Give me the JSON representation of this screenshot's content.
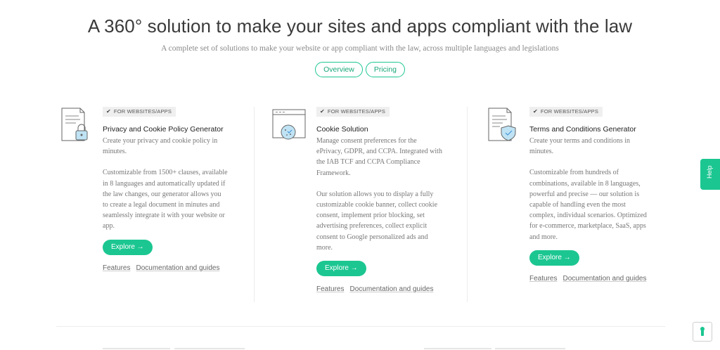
{
  "hero": {
    "title": "A 360° solution to make your sites and apps compliant with the law",
    "subtitle": "A complete set of solutions to make your website or app compliant with the law, across multiple languages and legislations",
    "pills": [
      "Overview",
      "Pricing"
    ]
  },
  "cards": [
    {
      "icon": "document-lock-icon",
      "badge": "FOR WEBSITES/APPS",
      "title": "Privacy and Cookie Policy Generator",
      "lines_p1": [
        "Create your privacy and cookie policy in",
        "minutes."
      ],
      "lines_p2": [
        "Customizable from 1500+ clauses, available",
        "in 8 languages and automatically updated if",
        "the law changes, our generator allows you",
        "to create a legal document in minutes and",
        "seamlessly integrate it with your website or",
        "app."
      ],
      "explore": "Explore →",
      "links": [
        "Features",
        "Documentation and guides"
      ]
    },
    {
      "icon": "browser-cookie-icon",
      "badge": "FOR WEBSITES/APPS",
      "title": "Cookie Solution",
      "lines_p1": [
        "Manage consent preferences for the",
        "ePrivacy, GDPR, and CCPA. Integrated with",
        "the IAB TCF and CCPA Compliance",
        "Framework."
      ],
      "lines_p2": [
        "Our solution allows you to display a fully",
        "customizable cookie banner, collect cookie",
        "consent, implement prior blocking, set",
        "advertising preferences, collect explicit",
        "consent to Google personalized ads and",
        "more."
      ],
      "explore": "Explore →",
      "links": [
        "Features",
        "Documentation and guides"
      ]
    },
    {
      "icon": "document-shield-icon",
      "badge": "FOR WEBSITES/APPS",
      "title": "Terms and Conditions Generator",
      "lines_p1": [
        "Create your terms and conditions in",
        "minutes."
      ],
      "lines_p2": [
        "Customizable from hundreds of",
        "combinations, available in 8 languages,",
        "powerful and precise — our solution is",
        "capable of handling even the most",
        "complex, individual scenarios. Optimized",
        "for e-commerce, marketplace, SaaS, apps",
        "and more."
      ],
      "explore": "Explore →",
      "links": [
        "Features",
        "Documentation and guides"
      ]
    }
  ],
  "help_tab": "Help",
  "colors": {
    "accent": "#1cc691",
    "accent_dark": "#17a779",
    "illustration": "#bfe3f4"
  }
}
